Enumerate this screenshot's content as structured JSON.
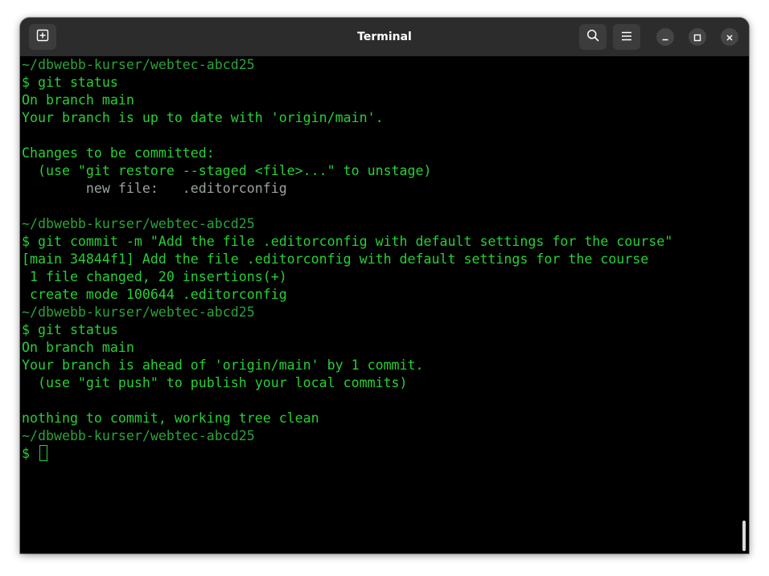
{
  "window": {
    "title": "Terminal"
  },
  "titlebar": {
    "new_tab_icon": "new-tab-icon",
    "search_icon": "search-icon",
    "menu_icon": "hamburger-menu-icon",
    "minimize_icon": "minimize-icon",
    "maximize_icon": "maximize-icon",
    "close_icon": "close-icon"
  },
  "terminal": {
    "lines": [
      {
        "text": "~/dbwebb-kurser/webtec-abcd25",
        "style": "dim"
      },
      {
        "text": "$ git status",
        "style": "normal"
      },
      {
        "text": "On branch main",
        "style": "normal"
      },
      {
        "text": "Your branch is up to date with 'origin/main'.",
        "style": "normal"
      },
      {
        "text": "",
        "style": "normal"
      },
      {
        "text": "Changes to be committed:",
        "style": "normal"
      },
      {
        "text": "  (use \"git restore --staged <file>...\" to unstage)",
        "style": "normal"
      },
      {
        "text": "        new file:   .editorconfig",
        "style": "muted"
      },
      {
        "text": "",
        "style": "normal"
      },
      {
        "text": "~/dbwebb-kurser/webtec-abcd25",
        "style": "dim"
      },
      {
        "text": "$ git commit -m \"Add the file .editorconfig with default settings for the course\"",
        "style": "normal"
      },
      {
        "text": "[main 34844f1] Add the file .editorconfig with default settings for the course",
        "style": "normal"
      },
      {
        "text": " 1 file changed, 20 insertions(+)",
        "style": "normal"
      },
      {
        "text": " create mode 100644 .editorconfig",
        "style": "normal"
      },
      {
        "text": "~/dbwebb-kurser/webtec-abcd25",
        "style": "dim"
      },
      {
        "text": "$ git status",
        "style": "normal"
      },
      {
        "text": "On branch main",
        "style": "normal"
      },
      {
        "text": "Your branch is ahead of 'origin/main' by 1 commit.",
        "style": "normal"
      },
      {
        "text": "  (use \"git push\" to publish your local commits)",
        "style": "normal"
      },
      {
        "text": "",
        "style": "normal"
      },
      {
        "text": "nothing to commit, working tree clean",
        "style": "normal"
      },
      {
        "text": "~/dbwebb-kurser/webtec-abcd25",
        "style": "dim"
      }
    ],
    "prompt": "$ "
  },
  "colors": {
    "terminal_bg": "#000000",
    "text_green": "#26d035",
    "prompt_path_green": "#2aa33a",
    "staged_file_gray": "#9aa39a",
    "titlebar_bg": "#2c2c2c"
  }
}
